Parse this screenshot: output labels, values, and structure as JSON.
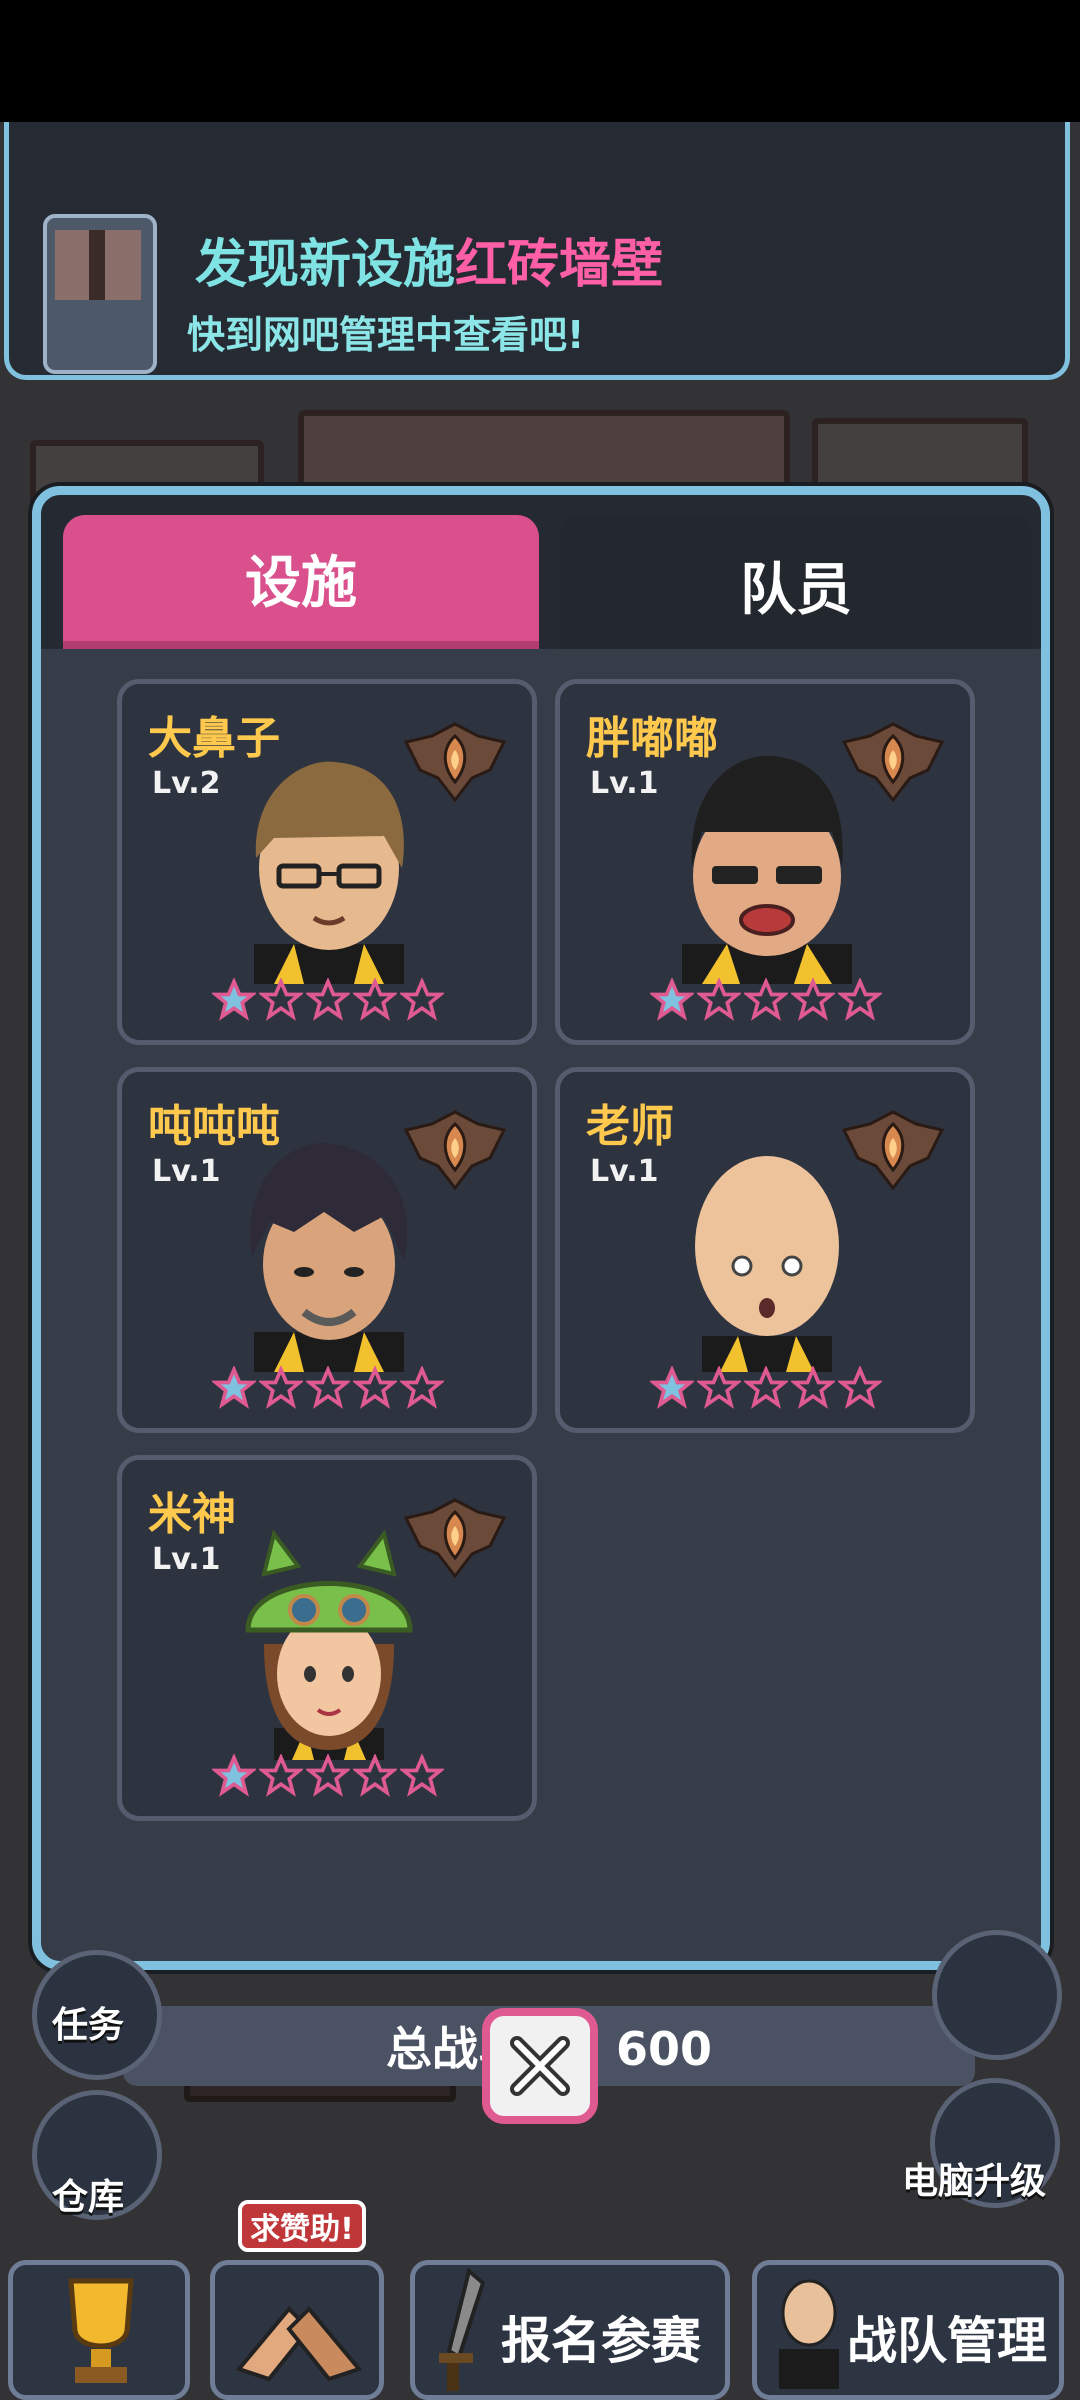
{
  "banner": {
    "title_prefix": "发现新设施",
    "title_highlight": "红砖墙壁",
    "subtitle": "快到网吧管理中查看吧!"
  },
  "tabs": {
    "facilities": "设施",
    "members": "队员"
  },
  "members": [
    {
      "name": "大鼻子",
      "level": "Lv.2",
      "stars_filled": 1,
      "stars_total": 5
    },
    {
      "name": "胖嘟嘟",
      "level": "Lv.1",
      "stars_filled": 1,
      "stars_total": 5
    },
    {
      "name": "吨吨吨",
      "level": "Lv.1",
      "stars_filled": 1,
      "stars_total": 5
    },
    {
      "name": "老师",
      "level": "Lv.1",
      "stars_filled": 1,
      "stars_total": 5
    },
    {
      "name": "米神",
      "level": "Lv.1",
      "stars_filled": 1,
      "stars_total": 5
    }
  ],
  "total_power": "总战斗力：600",
  "side_nav": {
    "tasks": "任务",
    "warehouse": "仓库",
    "pc_upgrade": "电脑升级"
  },
  "bottom_nav": {
    "sponsor_badge": "求赞助!",
    "register": "报名参赛",
    "team_manage": "战队管理"
  },
  "colors": {
    "accent_pink": "#d9508c",
    "frame_blue": "#7fc1de",
    "name_gold": "#ffc94d",
    "highlight_pink": "#ff5fa6",
    "banner_cyan": "#7fe3e4"
  },
  "icons": {
    "close": "close-icon",
    "rank": "rank-emblem-icon",
    "star_filled": "star-filled-icon",
    "star_empty": "star-empty-icon"
  }
}
